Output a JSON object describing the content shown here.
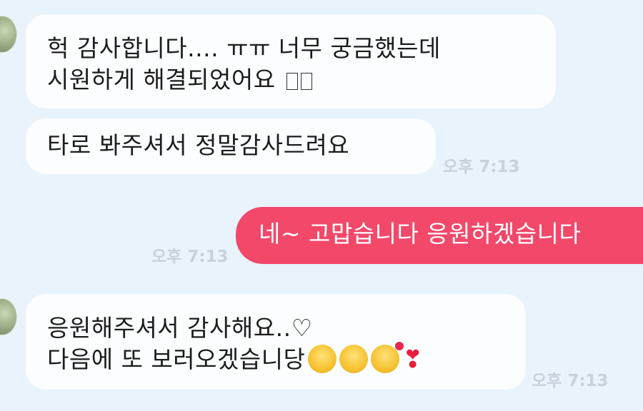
{
  "messages": [
    {
      "lines": [
        "헉 감사합니다....  ㅠㅠ 너무 궁금했는데",
        "시원하게 해결되었어요 "
      ],
      "time": ""
    },
    {
      "lines": [
        "타로 봐주셔서 정말감사드려요"
      ],
      "time": "오후 7:13"
    },
    {
      "text": "네~ 고맙습니다 응원하겠습니다",
      "time": "오후 7:13"
    },
    {
      "lines": [
        "응원해주셔서 감사해요..♡",
        "다음에 또 보러오겠습니당"
      ],
      "time": "오후 7:13"
    }
  ],
  "icons": {
    "avatar": "profile-avatar",
    "emojis": [
      "hugging-face-icon",
      "hugging-face-icon",
      "smiling-face-with-hearts-icon",
      "red-exclamation-heart-icon"
    ]
  },
  "colors": {
    "background": "#e8f3fb",
    "incoming_bubble": "#fbfdff",
    "outgoing_bubble": "#f2486a",
    "timestamp": "#c7d2dd"
  }
}
